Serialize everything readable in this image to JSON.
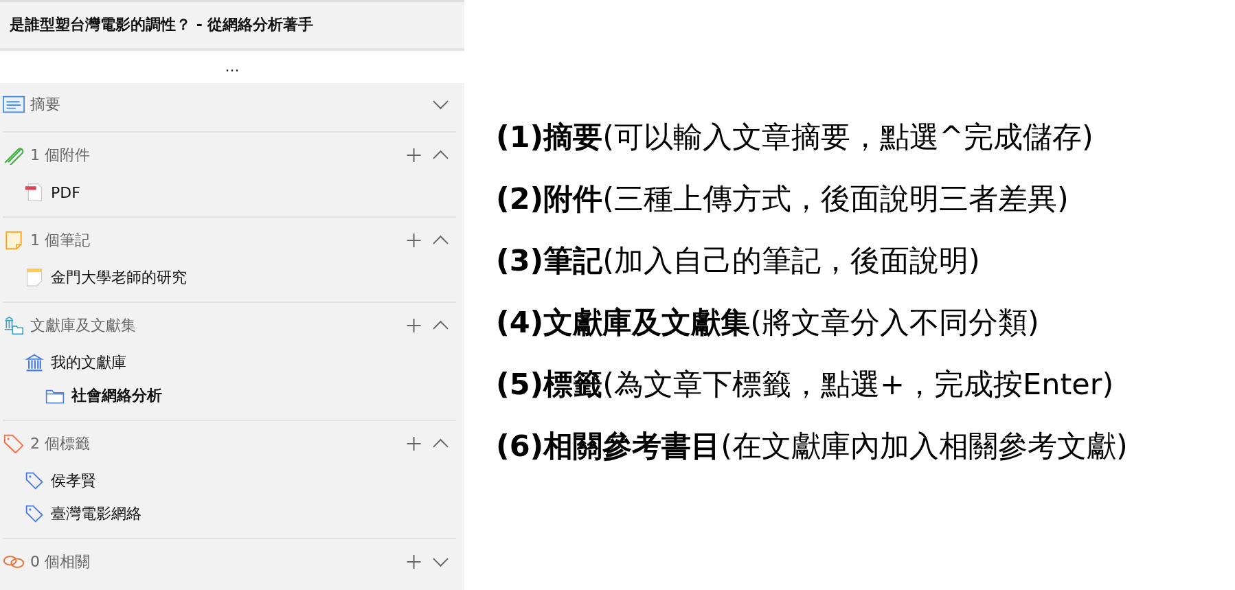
{
  "item_pane": {
    "title": "是誰型塑台灣電影的調性？ - 從網絡分析著手",
    "more_button": "...",
    "sections": [
      {
        "kind": "abstract",
        "label": "摘要",
        "addable": false,
        "expanded": false
      },
      {
        "kind": "attachments",
        "label": "1 個附件",
        "addable": true,
        "expanded": true,
        "items": [
          {
            "kind": "pdf",
            "label": "PDF",
            "selected": false
          }
        ]
      },
      {
        "kind": "notes",
        "label": "1 個筆記",
        "addable": true,
        "expanded": true,
        "items": [
          {
            "kind": "note",
            "label": "金門大學老師的研究",
            "selected": false
          }
        ]
      },
      {
        "kind": "libraries",
        "label": "文獻庫及文獻集",
        "addable": true,
        "expanded": true,
        "items": [
          {
            "kind": "library",
            "label": "我的文獻庫",
            "selected": false,
            "children": [
              {
                "kind": "collection",
                "label": "社會網絡分析",
                "selected": true
              }
            ]
          }
        ]
      },
      {
        "kind": "tags",
        "label": "2 個標籤",
        "addable": true,
        "expanded": true,
        "items": [
          {
            "kind": "tag",
            "label": "侯孝賢",
            "selected": false
          },
          {
            "kind": "tag",
            "label": "臺灣電影網絡",
            "selected": false
          }
        ]
      },
      {
        "kind": "related",
        "label": "0 個相關",
        "addable": true,
        "expanded": false
      }
    ]
  },
  "notes": [
    "**(1)摘要**(可以輸入文章摘要，點選^完成儲存)",
    "**(2)附件**(三種上傳方式，後面說明三者差異)",
    "**(3)筆記**(加入自己的筆記，後面說明)",
    "**(4)文獻庫及文獻集**(將文章分入不同分類)",
    "**(5)標籤**(為文章下標籤，點選+，完成按Enter)",
    "**(6)相關參考書目**(在文獻庫內加入相關參考文獻)"
  ]
}
